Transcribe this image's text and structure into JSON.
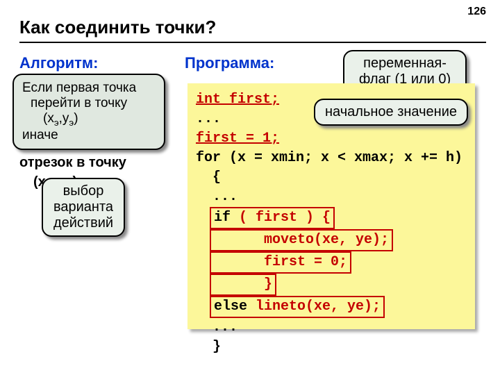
{
  "pagenum": "126",
  "title": "Как соединить точки?",
  "sections": {
    "alg": "Алгоритм:",
    "prog": "Программа:"
  },
  "alg_bg": {
    "l5": "отрезок в точку",
    "l6": "(xэ,yэ)"
  },
  "algbox": {
    "l1": "Если первая точка",
    "l2": "перейти в точку",
    "l3a": "(x",
    "l3s1": "э",
    "l3b": ",y",
    "l3s2": "э",
    "l3c": ")",
    "l4": "иначе"
  },
  "callouts": {
    "choice_l1": "выбор",
    "choice_l2": "варианта",
    "choice_l3": "действий",
    "flag_l1": "переменная-",
    "flag_l2": "флаг (1 или 0)",
    "initial": "начальное значение"
  },
  "code": {
    "c1": "int first;",
    "c2": "...",
    "c3": "first = 1;",
    "c4": "for (x = xmin; x < xmax; x += h)",
    "c5": "  {",
    "c6": "  ...",
    "c7a": "  ",
    "c7b": "if",
    "c7c": " ( first ) {",
    "c8": "      moveto(xe, ye);",
    "c9": "      first = 0;",
    "c10": "      }",
    "c11a": "  ",
    "c11b": "else",
    "c11c": " lineto(xe, ye);",
    "c12": "  ...",
    "c13": "  }"
  }
}
